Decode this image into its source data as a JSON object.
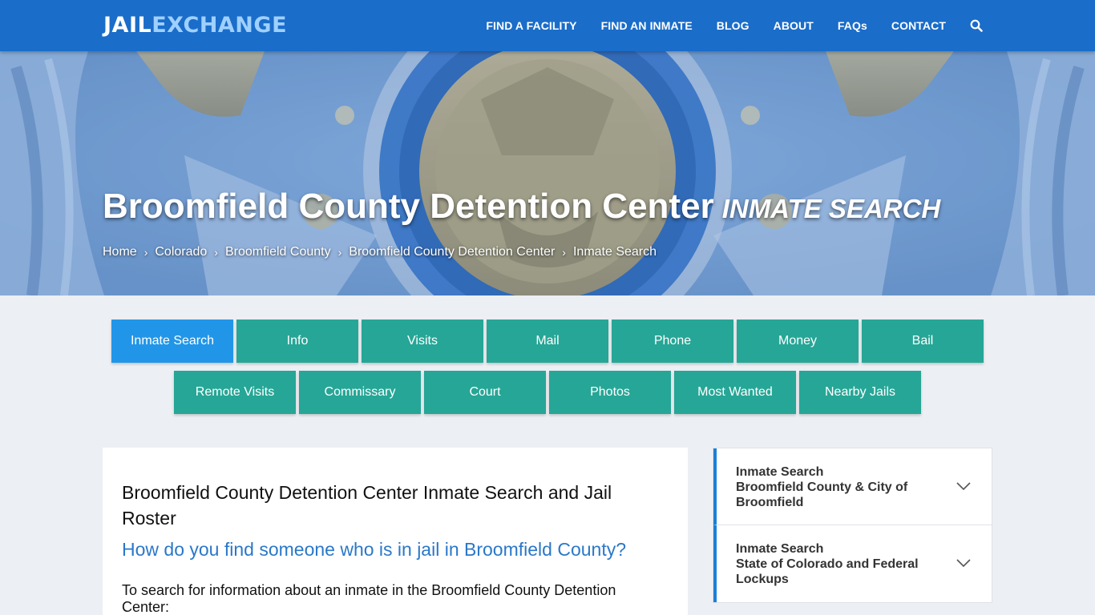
{
  "brand": {
    "part1": "JAIL",
    "part2": "EXCHANGE"
  },
  "nav": {
    "items": [
      "FIND A FACILITY",
      "FIND AN INMATE",
      "BLOG",
      "ABOUT",
      "FAQs",
      "CONTACT"
    ],
    "search_icon": "search-icon"
  },
  "hero": {
    "title": "Broomfield County Detention Center",
    "subtitle": "INMATE SEARCH",
    "breadcrumb": [
      "Home",
      "Colorado",
      "Broomfield County",
      "Broomfield County Detention Center",
      "Inmate Search"
    ]
  },
  "tabs": {
    "row1": [
      "Inmate Search",
      "Info",
      "Visits",
      "Mail",
      "Phone",
      "Money",
      "Bail"
    ],
    "row2": [
      "Remote Visits",
      "Commissary",
      "Court",
      "Photos",
      "Most Wanted",
      "Nearby Jails"
    ],
    "active": "Inmate Search"
  },
  "main": {
    "heading": "Broomfield County Detention Center Inmate Search and Jail Roster",
    "question": "How do you find someone who is in jail in Broomfield County?",
    "intro": "To search for information about an inmate in the Broomfield County Detention Center:"
  },
  "sidebar": {
    "items": [
      {
        "label": "Inmate Search",
        "title": "Broomfield County & City of Broomfield"
      },
      {
        "label": "Inmate Search",
        "title": "State of Colorado and Federal Lockups"
      }
    ]
  },
  "colors": {
    "navbar": "#1a6dc9",
    "tab": "#26a696",
    "tab_active": "#2196e8",
    "link_heading": "#2a78c9",
    "accordion_accent": "#1a7fd8"
  }
}
